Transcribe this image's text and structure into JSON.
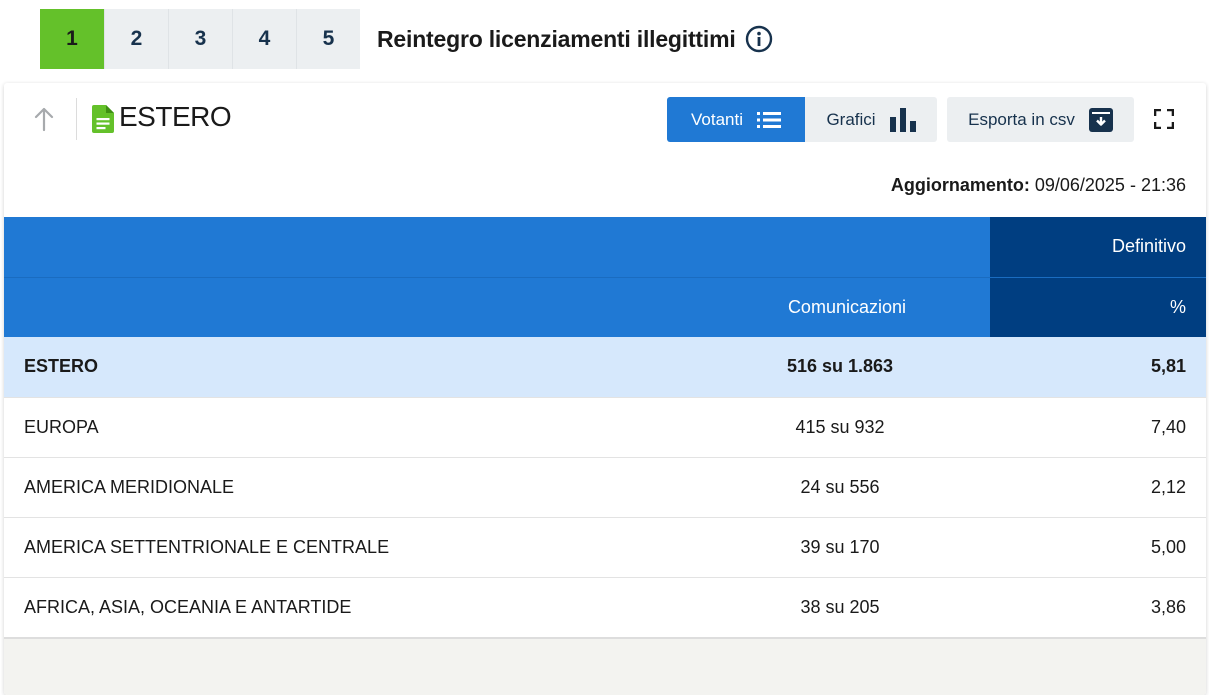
{
  "steps": [
    "1",
    "2",
    "3",
    "4",
    "5"
  ],
  "active_step": "1",
  "quesito_title": "Reintegro licenziamenti illegittimi",
  "area_title": "ESTERO",
  "toolbar": {
    "votanti_label": "Votanti",
    "grafici_label": "Grafici",
    "csv_label": "Esporta in csv"
  },
  "update": {
    "label": "Aggiornamento:",
    "value": "09/06/2025 - 21:36"
  },
  "table": {
    "header_top": "Definitivo",
    "col_comunicazioni": "Comunicazioni",
    "col_percent": "%",
    "rows": [
      {
        "name": "ESTERO",
        "comunicazioni": "516 su 1.863",
        "percent": "5,81",
        "total": true
      },
      {
        "name": "EUROPA",
        "comunicazioni": "415 su 932",
        "percent": "7,40"
      },
      {
        "name": "AMERICA MERIDIONALE",
        "comunicazioni": "24 su 556",
        "percent": "2,12"
      },
      {
        "name": "AMERICA SETTENTRIONALE E CENTRALE",
        "comunicazioni": "39 su 170",
        "percent": "5,00"
      },
      {
        "name": "AFRICA, ASIA, OCEANIA E ANTARTIDE",
        "comunicazioni": "38 su 205",
        "percent": "3,86"
      }
    ]
  },
  "colors": {
    "step_active": "#64c12a",
    "primary_blue": "#2079d4",
    "dark_blue": "#003e81",
    "total_row_bg": "#d6e8fc"
  },
  "icons": [
    "info-icon",
    "arrow-up-icon",
    "document-icon",
    "list-icon",
    "bar-chart-icon",
    "download-box-icon",
    "fullscreen-icon"
  ]
}
